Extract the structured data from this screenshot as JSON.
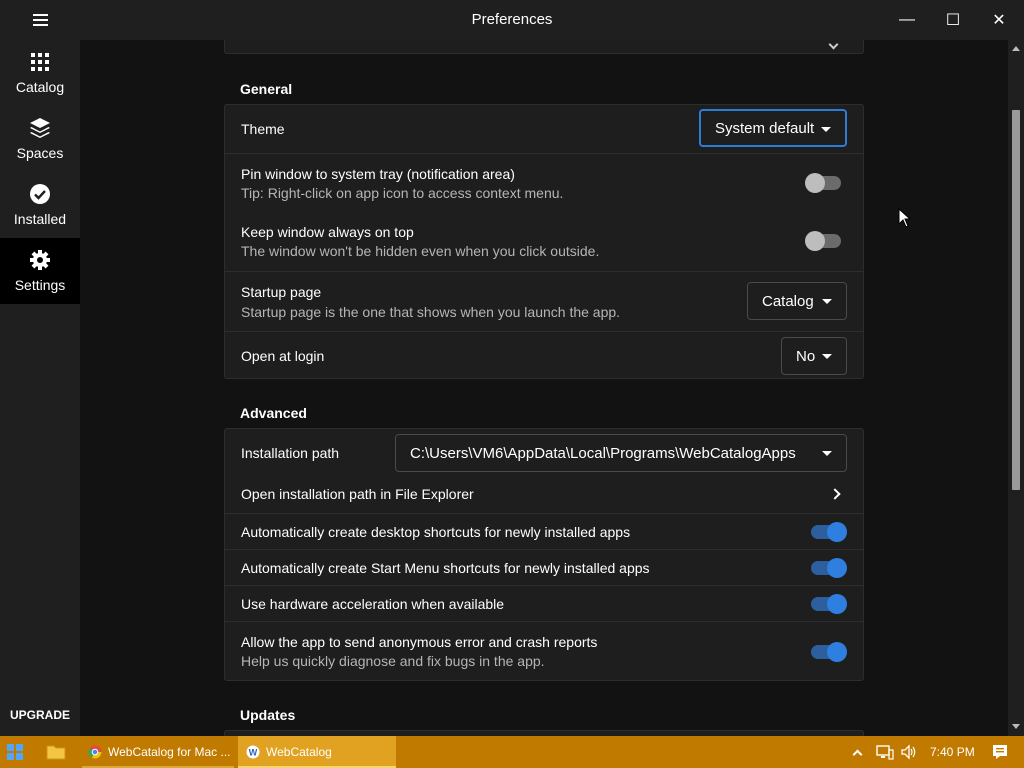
{
  "window": {
    "title": "Preferences",
    "minimize": "—",
    "maximize": "☐",
    "close": "✕"
  },
  "sidebar": {
    "items": [
      {
        "label": "Catalog",
        "icon": "grid-icon"
      },
      {
        "label": "Spaces",
        "icon": "layers-icon"
      },
      {
        "label": "Installed",
        "icon": "check-circle-icon"
      },
      {
        "label": "Settings",
        "icon": "gear-icon",
        "active": true
      }
    ],
    "upgrade": "UPGRADE"
  },
  "general": {
    "title": "General",
    "theme": {
      "label": "Theme",
      "value": "System default"
    },
    "pin_tray": {
      "label": "Pin window to system tray (notification area)",
      "sub": "Tip: Right-click on app icon to access context menu.",
      "on": false
    },
    "always_on_top": {
      "label": "Keep window always on top",
      "sub": "The window won't be hidden even when you click outside.",
      "on": false
    },
    "startup_page": {
      "label": "Startup page",
      "sub": "Startup page is the one that shows when you launch the app.",
      "value": "Catalog"
    },
    "open_at_login": {
      "label": "Open at login",
      "value": "No"
    }
  },
  "advanced": {
    "title": "Advanced",
    "install_path": {
      "label": "Installation path",
      "value": "C:\\Users\\VM6\\AppData\\Local\\Programs\\WebCatalogApps"
    },
    "open_explorer": {
      "label": "Open installation path in File Explorer"
    },
    "desktop_shortcuts": {
      "label": "Automatically create desktop shortcuts for newly installed apps",
      "on": true
    },
    "start_menu_shortcuts": {
      "label": "Automatically create Start Menu shortcuts for newly installed apps",
      "on": true
    },
    "hw_accel": {
      "label": "Use hardware acceleration when available",
      "on": true
    },
    "crash_reports": {
      "label": "Allow the app to send anonymous error and crash reports",
      "sub": "Help us quickly diagnose and fix bugs in the app.",
      "on": true
    }
  },
  "updates": {
    "title": "Updates"
  },
  "taskbar": {
    "chrome_label": "WebCatalog for Mac ...",
    "webcatalog_label": "WebCatalog",
    "time": "7:40 PM"
  },
  "colors": {
    "accent": "#2f7fe0",
    "taskbar": "#c07a00"
  }
}
